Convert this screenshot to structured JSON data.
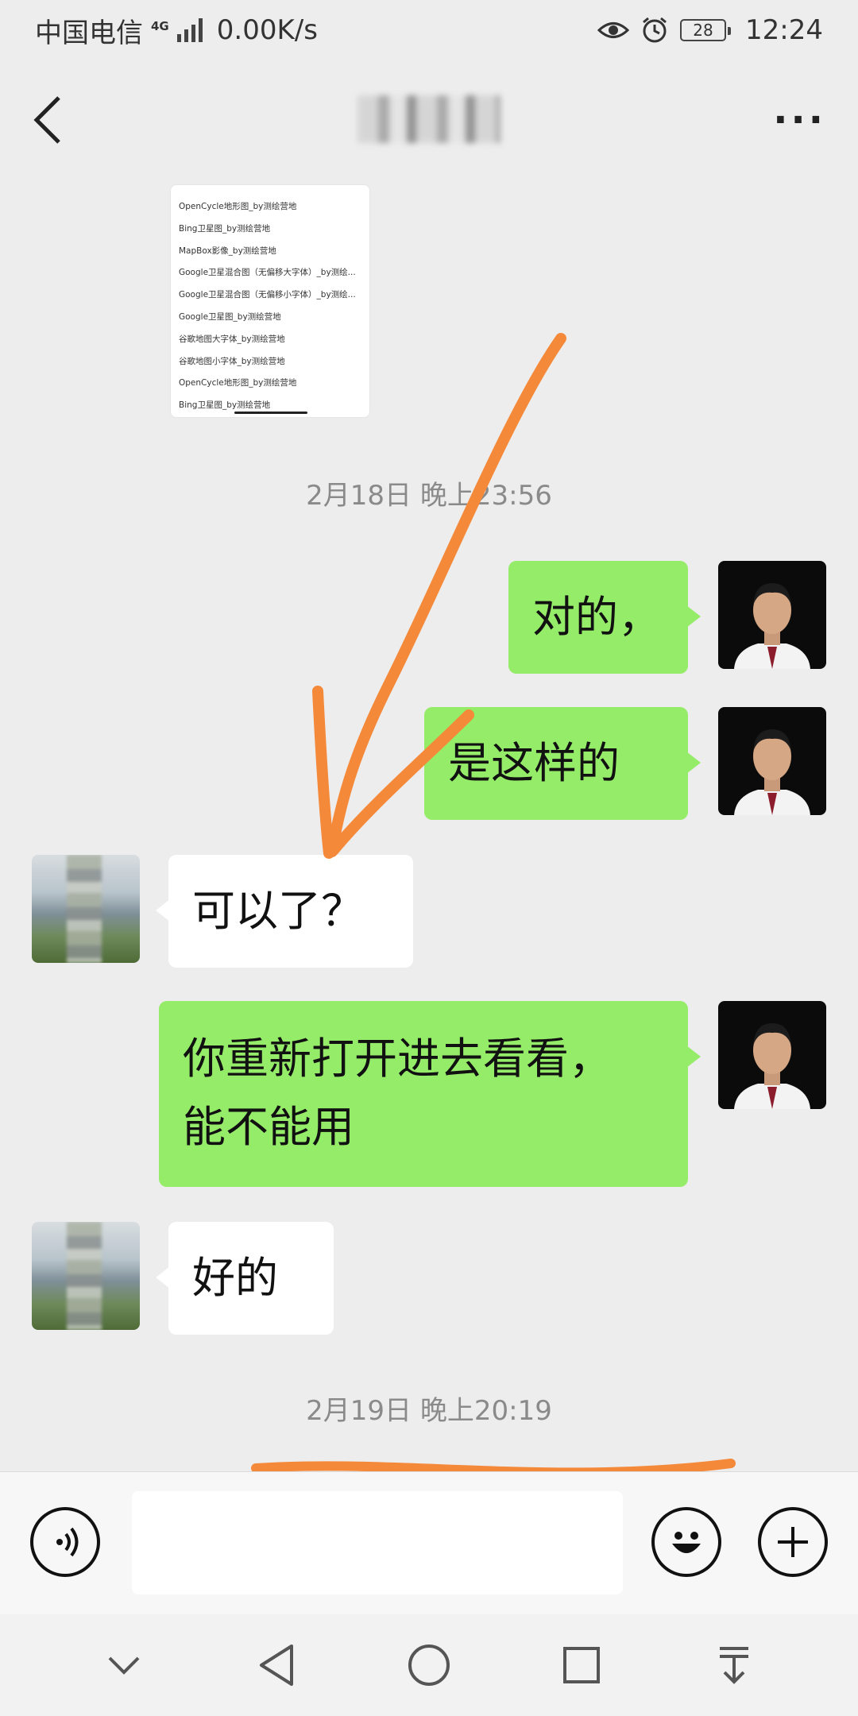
{
  "status_bar": {
    "carrier": "中国电信",
    "network_type": "4G",
    "speed": "0.00K/s",
    "battery": "28",
    "time": "12:24"
  },
  "header": {
    "more_label": "···"
  },
  "shared_file": {
    "items": [
      "OpenCycle地形图_by测绘营地",
      "Bing卫星图_by测绘营地",
      "MapBox影像_by测绘营地",
      "Google卫星混合图（无偏移大字体）_by测绘...",
      "Google卫星混合图（无偏移小字体）_by测绘...",
      "Google卫星图_by测绘营地",
      "谷歌地图大字体_by测绘营地",
      "谷歌地图小字体_by测绘营地",
      "OpenCycle地形图_by测绘营地",
      "Bing卫星图_by测绘营地"
    ]
  },
  "messages": {
    "timestamp_1": "2月18日 晚上23:56",
    "msg_1": "对的，",
    "msg_2": "是这样的",
    "msg_3": "可以了？",
    "msg_4_line1": "你重新打开进去看看，",
    "msg_4_line2": "能不能用",
    "msg_5": "好的",
    "timestamp_2": "2月19日 晚上20:19"
  },
  "input_bar": {
    "text_value": ""
  },
  "colors": {
    "self_bubble": "#95ec69",
    "other_bubble": "#ffffff",
    "background": "#ededed",
    "annotation": "#f5893a"
  }
}
